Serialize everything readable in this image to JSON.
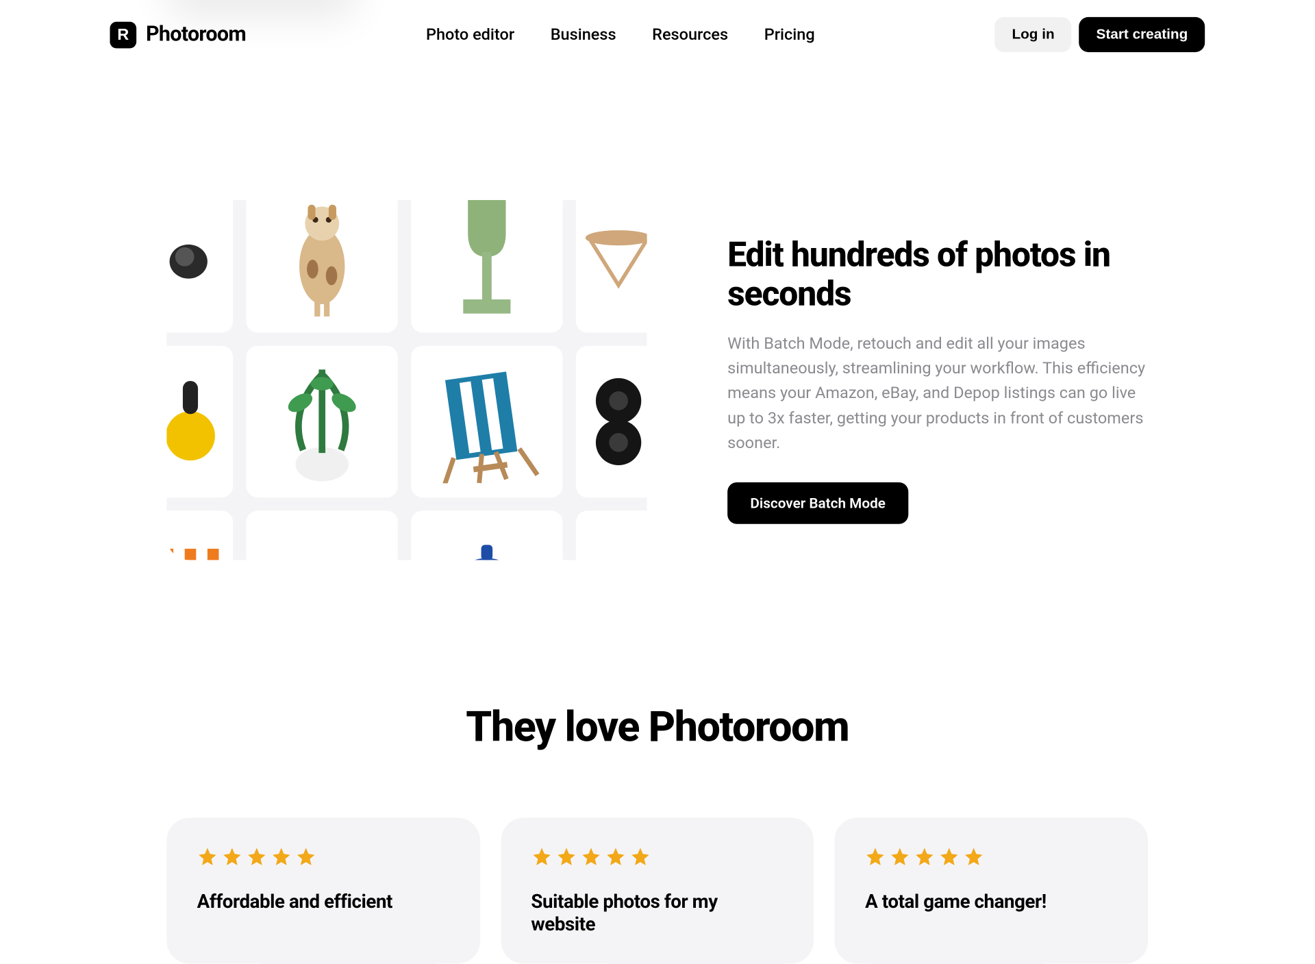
{
  "brand": {
    "name": "Photoroom"
  },
  "nav": {
    "items": [
      {
        "label": "Photo editor"
      },
      {
        "label": "Business"
      },
      {
        "label": "Resources"
      },
      {
        "label": "Pricing"
      }
    ]
  },
  "header": {
    "login": "Log in",
    "cta": "Start creating"
  },
  "feature": {
    "title": "Edit hundreds of photos in seconds",
    "desc": "With Batch Mode, retouch and edit all your images simultaneously, streamlining your workflow. This efficiency means your Amazon, eBay, and Depop listings can go live up to 3x faster, getting your products in front of customers sooner.",
    "cta": "Discover Batch Mode"
  },
  "testimonials": {
    "title": "They love Photoroom",
    "cards": [
      {
        "title": "Affordable and efficient",
        "rating": 5
      },
      {
        "title": "Suitable photos for my website",
        "rating": 5
      },
      {
        "title": "A total game changer!",
        "rating": 5
      }
    ]
  }
}
